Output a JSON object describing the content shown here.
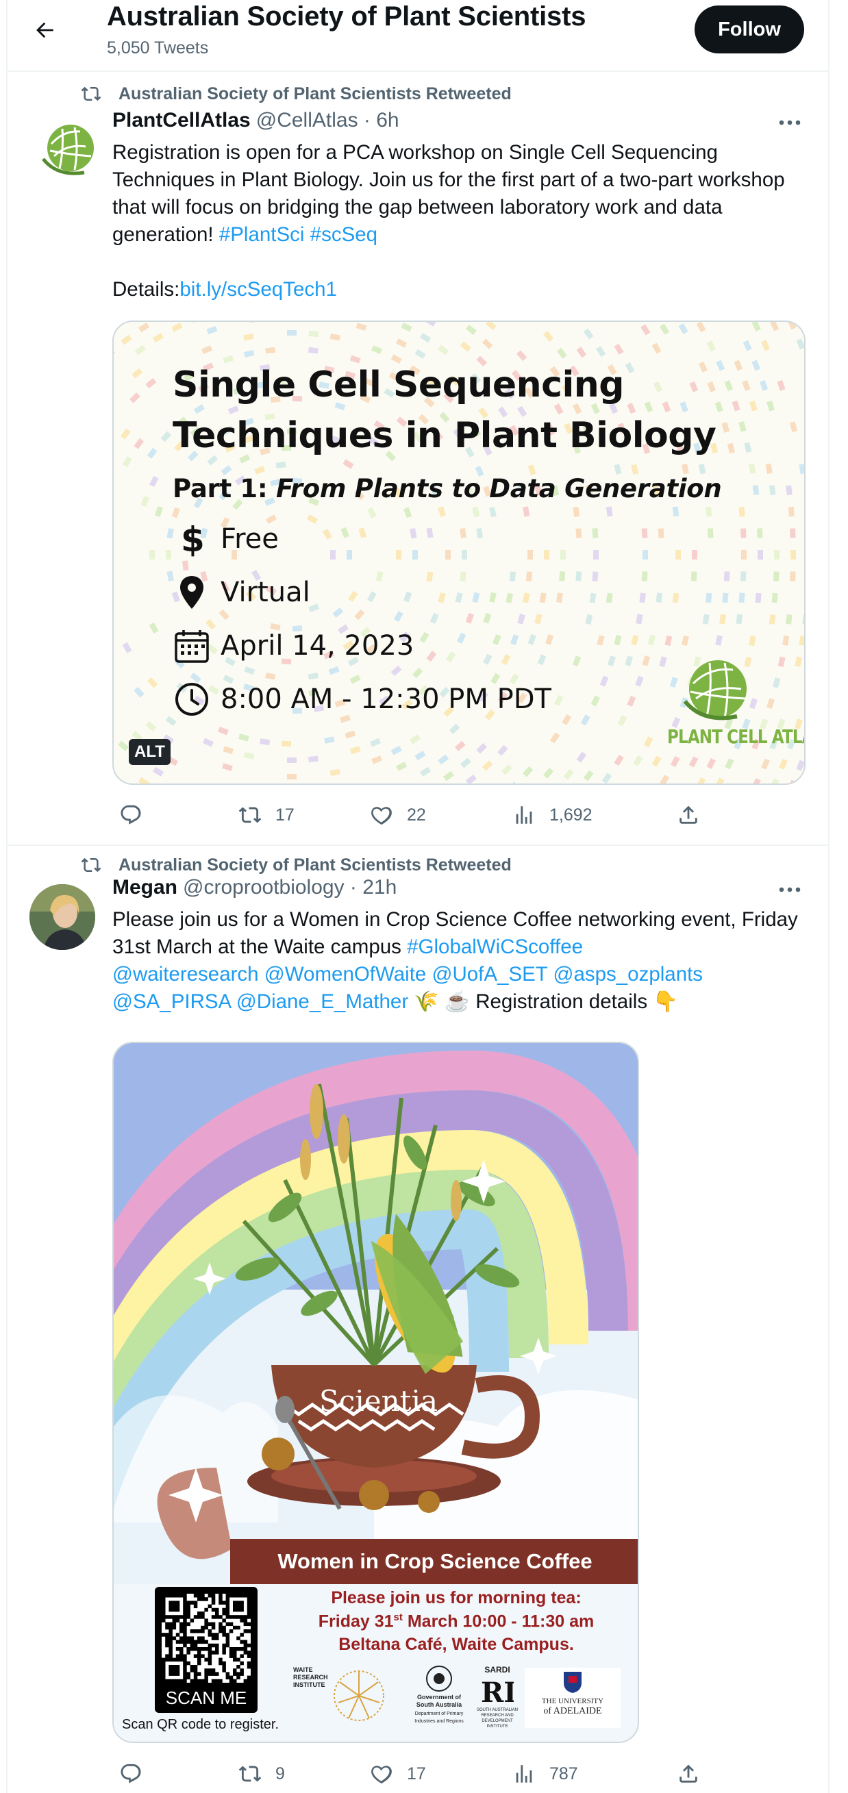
{
  "header": {
    "title": "Australian Society of Plant Scientists",
    "subtitle": "5,050 Tweets",
    "follow_label": "Follow"
  },
  "tweets": [
    {
      "retweeted_by": "Australian Society of Plant Scientists Retweeted",
      "name": "PlantCellAtlas",
      "handle_time": "@CellAtlas · 6h",
      "text_main": "Registration is open for a PCA workshop on Single Cell Sequencing Techniques in Plant Biology. Join us for the first part of a two-part workshop that will focus on bridging the gap between laboratory work and data generation! ",
      "hashtag1": "#PlantSci",
      "hashtag2": "#scSeq",
      "details_label": "Details:",
      "details_link": "bit.ly/scSeqTech1",
      "media": {
        "title_line1": "Single Cell Sequencing",
        "title_line2": "Techniques in Plant Biology",
        "part_prefix": "Part 1: ",
        "part_italic": "From Plants to Data Generation",
        "cost": "Free",
        "location": "Virtual",
        "date": "April 14, 2023",
        "time": "8:00 AM - 12:30 PM PDT",
        "alt_badge": "ALT",
        "logo_text": "PLANT CELL ATLAS"
      },
      "actions": {
        "replies": "",
        "retweets": "17",
        "likes": "22",
        "views": "1,692"
      }
    },
    {
      "retweeted_by": "Australian Society of Plant Scientists Retweeted",
      "name": "Megan",
      "handle_time": "@croprootbiology · 21h",
      "text_part1": "Please join us for a Women in Crop Science Coffee networking event, Friday 31st March at the Waite campus ",
      "hashtag": "#GlobalWiCScoffee",
      "mention1": "@waiteresearch",
      "mention2": "@WomenOfWaite",
      "mention3": "@UofA_SET",
      "mention4": "@asps_ozplants",
      "mention5": "@SA_PIRSA",
      "mention6": "@Diane_E_Mather",
      "text_end": " 🌾 ☕ Registration details 👇",
      "media": {
        "cup_label": "Scientia",
        "banner": "Women in Crop Science Coffee",
        "line1": "Please join us for morning tea:",
        "line2_pre": "Friday 31",
        "line2_sup": "st",
        "line2_post": " March 10:00 - 11:30 am",
        "line3": "Beltana Café, Waite Campus.",
        "scan_me": "SCAN ME",
        "scan_caption": "Scan QR code to register.",
        "logo_waite": "WAITE RESEARCH INSTITUTE",
        "logo_gov": "Government of South Australia",
        "logo_gov_sub": "Department of Primary Industries and Regions",
        "logo_sardi": "SARDI",
        "logo_sardi_sub": "SOUTH AUSTRALIAN RESEARCH AND DEVELOPMENT INSTITUTE",
        "logo_uni_line1": "THE UNIVERSITY",
        "logo_uni_line2": "of ADELAIDE"
      },
      "actions": {
        "replies": "",
        "retweets": "9",
        "likes": "17",
        "views": "787"
      }
    }
  ],
  "colors": {
    "link": "#1d9bf0",
    "secondary_text": "#536471",
    "border": "#eff3f4"
  }
}
